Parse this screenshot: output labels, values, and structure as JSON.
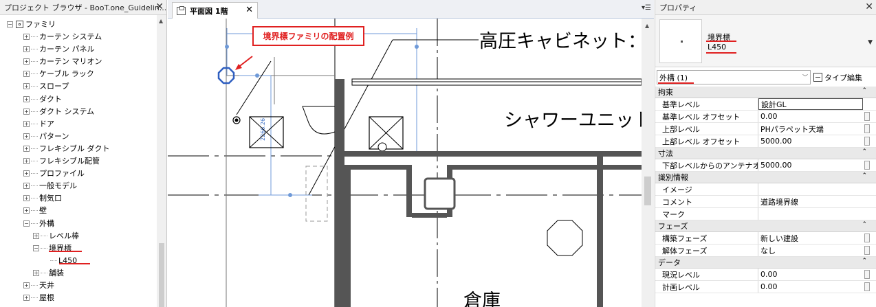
{
  "browser": {
    "title": "プロジェクト ブラウザ - BooT.one_Guidelin...",
    "close": "✕",
    "root": "ファミリ",
    "items": [
      {
        "label": "カーテン システム",
        "level": 1,
        "exp": "+"
      },
      {
        "label": "カーテン パネル",
        "level": 1,
        "exp": "+"
      },
      {
        "label": "カーテン マリオン",
        "level": 1,
        "exp": "+"
      },
      {
        "label": "ケーブル ラック",
        "level": 1,
        "exp": "+"
      },
      {
        "label": "スロープ",
        "level": 1,
        "exp": "+"
      },
      {
        "label": "ダクト",
        "level": 1,
        "exp": "+"
      },
      {
        "label": "ダクト システム",
        "level": 1,
        "exp": "+"
      },
      {
        "label": "ドア",
        "level": 1,
        "exp": "+"
      },
      {
        "label": "パターン",
        "level": 1,
        "exp": "+"
      },
      {
        "label": "フレキシブル ダクト",
        "level": 1,
        "exp": "+"
      },
      {
        "label": "フレキシブル配管",
        "level": 1,
        "exp": "+"
      },
      {
        "label": "プロファイル",
        "level": 1,
        "exp": "+"
      },
      {
        "label": "一般モデル",
        "level": 1,
        "exp": "+"
      },
      {
        "label": "制気口",
        "level": 1,
        "exp": "+"
      },
      {
        "label": "壁",
        "level": 1,
        "exp": "+"
      },
      {
        "label": "外構",
        "level": 1,
        "exp": "−"
      },
      {
        "label": "レベル棒",
        "level": 2,
        "exp": "+"
      },
      {
        "label": "境界標",
        "level": 2,
        "exp": "−"
      },
      {
        "label": "L450",
        "level": 3,
        "exp": ""
      },
      {
        "label": "舗装",
        "level": 2,
        "exp": "+"
      },
      {
        "label": "天井",
        "level": 1,
        "exp": "+"
      },
      {
        "label": "屋根",
        "level": 1,
        "exp": "+"
      }
    ]
  },
  "view": {
    "tab_label": "平面図 1階",
    "tab_close": "✕",
    "callout": "境界標ファミリの配置例",
    "labels": {
      "cabinet": "高圧キャビネット：",
      "shower": "シャワーユニット",
      "storage": "倉庫",
      "dimension": "2266.26"
    }
  },
  "props": {
    "title": "プロパティ",
    "close": "✕",
    "type_family": "境界標",
    "type_name": "L450",
    "filter": "外構 (1)",
    "edit_type": "タイプ編集",
    "groups": [
      {
        "name": "拘束",
        "rows": [
          {
            "name": "基準レベル",
            "value": "設計GL"
          },
          {
            "name": "基準レベル オフセット",
            "value": "0.00"
          },
          {
            "name": "上部レベル",
            "value": "PHパラペット天端"
          },
          {
            "name": "上部レベル オフセット",
            "value": "5000.00"
          }
        ]
      },
      {
        "name": "寸法",
        "rows": [
          {
            "name": "下部レベルからのアンテナオ...",
            "value": "5000.00"
          }
        ]
      },
      {
        "name": "識別情報",
        "rows": [
          {
            "name": "イメージ",
            "value": ""
          },
          {
            "name": "コメント",
            "value": "道路境界線"
          },
          {
            "name": "マーク",
            "value": ""
          }
        ]
      },
      {
        "name": "フェーズ",
        "rows": [
          {
            "name": "構築フェーズ",
            "value": "新しい建設"
          },
          {
            "name": "解体フェーズ",
            "value": "なし"
          }
        ]
      },
      {
        "name": "データ",
        "rows": [
          {
            "name": "現況レベル",
            "value": "0.00"
          },
          {
            "name": "計画レベル",
            "value": "0.00"
          }
        ]
      }
    ]
  },
  "colors": {
    "accent": "#e02020",
    "selection": "#3b6fc4",
    "wall": "#555555"
  }
}
